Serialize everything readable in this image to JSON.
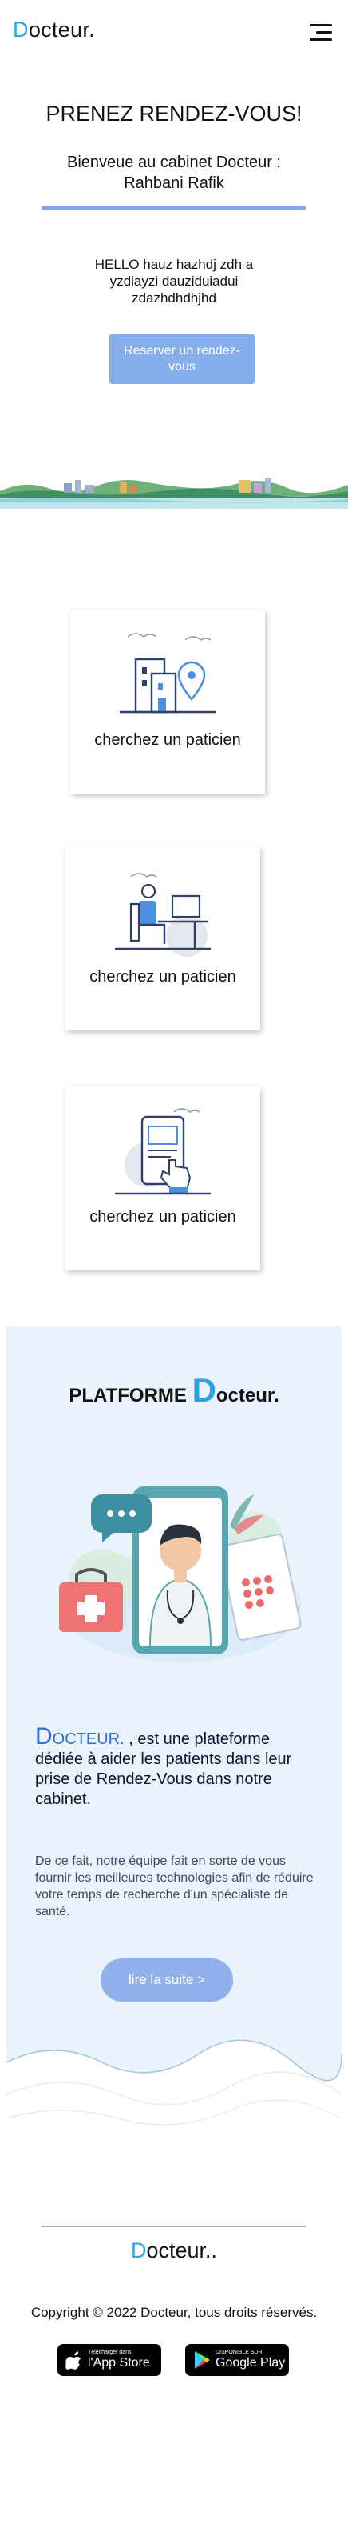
{
  "header": {
    "logo_initial": "D",
    "logo_rest": "octeur."
  },
  "hero": {
    "title": "PRENEZ RENDEZ-VOUS!",
    "subtitle": "Bienveue au cabinet Docteur : Rahbani Rafik",
    "text": "HELLO hauz hazhdj zdh a yzdiayzi dauziduiadui zdazhdhdhjhd",
    "button_label": "Reserver un rendez-vous"
  },
  "cards": [
    {
      "label": "cherchez un paticien",
      "icon": "building-location-icon"
    },
    {
      "label": "cherchez un paticien",
      "icon": "person-desk-icon"
    },
    {
      "label": "cherchez un paticien",
      "icon": "tablet-touch-icon"
    }
  ],
  "platform": {
    "title_prefix": "PLATFORME ",
    "title_initial": "D",
    "title_rest": "octeur.",
    "p1_initial": "D",
    "p1_smallcaps": "OCTEUR.",
    "p1_rest": " , est une plateforme dédiée à aider les patients dans leur prise de Rendez-Vous dans notre cabinet.",
    "p2": "De ce fait, notre équipe fait en sorte de vous fournir les meilleures technologies afin de réduire votre temps de recherche d'un spécialiste de santé.",
    "button_label": "lire la suite >"
  },
  "footer": {
    "logo_initial": "D",
    "logo_rest": "octeur..",
    "copyright": "Copyright © 2022 Docteur, tous droits réservés.",
    "appstore_small": "Télécharger dans",
    "appstore_big": "l'App Store",
    "gplay_small": "DISPONIBLE SUR",
    "gplay_big": "Google Play"
  },
  "colors": {
    "accent": "#2aa5e0",
    "button": "#86adec",
    "section_bg": "#eaf3fc"
  }
}
